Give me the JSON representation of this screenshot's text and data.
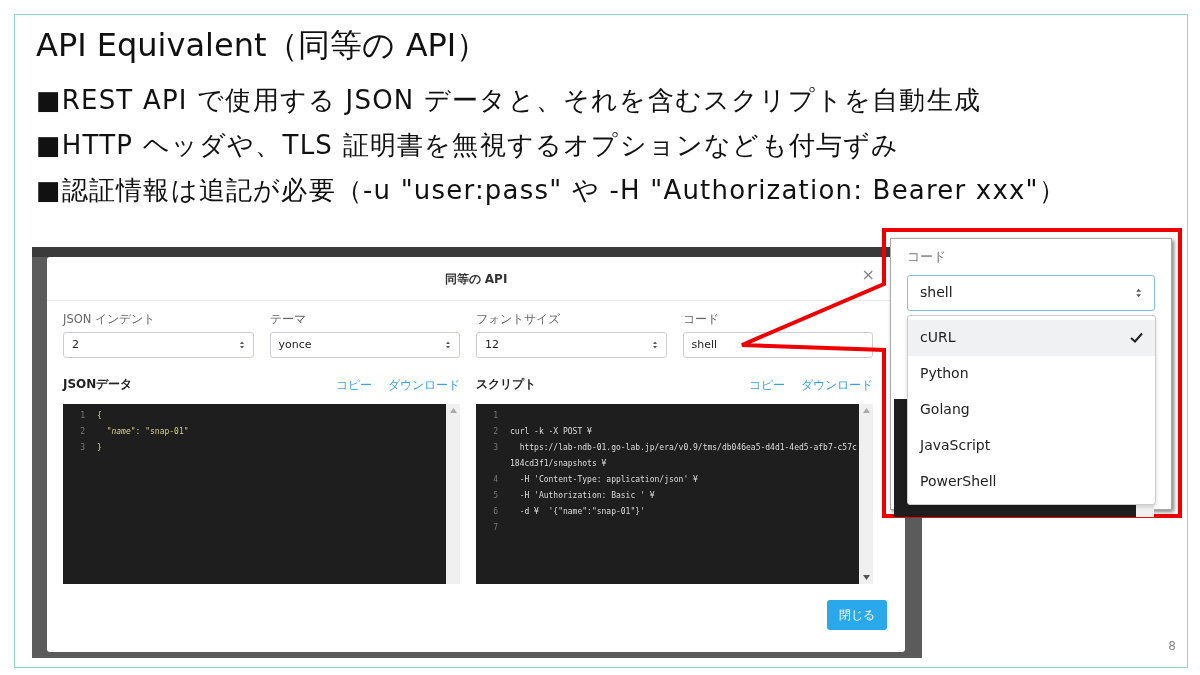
{
  "slide": {
    "title": "API Equivalent（同等の API）",
    "bullets": [
      "■REST API で使用する JSON データと、それを含むスクリプトを自動生成",
      "■HTTP ヘッダや、TLS 証明書を無視するオプションなども付与ずみ",
      "■認証情報は追記が必要（-u \"user:pass\" や -H \"Authorization: Bearer xxx\"）"
    ],
    "page_number": "8"
  },
  "dialog": {
    "title": "同等の API",
    "close": "×",
    "fields": [
      {
        "label": "JSON インデント",
        "value": "2"
      },
      {
        "label": "テーマ",
        "value": "yonce"
      },
      {
        "label": "フォントサイズ",
        "value": "12"
      },
      {
        "label": "コード",
        "value": "shell",
        "kind": "plain"
      }
    ],
    "panels": [
      {
        "title": "JSONデータ",
        "actions": [
          "コピー",
          "ダウンロード"
        ],
        "lines": [
          {
            "number": "1",
            "text": "{"
          },
          {
            "number": "2",
            "text": "  *\"name\"*: \"snap-01\""
          },
          {
            "number": "3",
            "text": "}"
          }
        ]
      },
      {
        "title": "スクリプト",
        "actions": [
          "コピー",
          "ダウンロード"
        ],
        "lines": [
          {
            "number": "1"
          },
          {
            "number": "2",
            "text": "curl -k -X POST ¥"
          },
          {
            "number": "3",
            "text": "  https://lab-ndb-01.go-lab.jp/era/v0.9/tms/db046ea5-d4d1-4ed5-afb7-c57c184cd3f1/snapshots ¥"
          },
          {
            "number": "4",
            "text": "  -H 'Content-Type: application/json' ¥"
          },
          {
            "number": "5",
            "text": "  -H 'Authorization: Basic ' ¥"
          },
          {
            "number": "6",
            "text": "  -d ¥  '{\"name\":\"snap-01\"}'"
          },
          {
            "number": "7"
          }
        ]
      }
    ],
    "close_button": "閉じる"
  },
  "inset": {
    "label": "コード",
    "value": "shell",
    "options": [
      {
        "label": "cURL",
        "selected": true
      },
      {
        "label": "Python",
        "selected": false
      },
      {
        "label": "Golang",
        "selected": false
      },
      {
        "label": "JavaScript",
        "selected": false
      },
      {
        "label": "PowerShell",
        "selected": false
      }
    ]
  }
}
